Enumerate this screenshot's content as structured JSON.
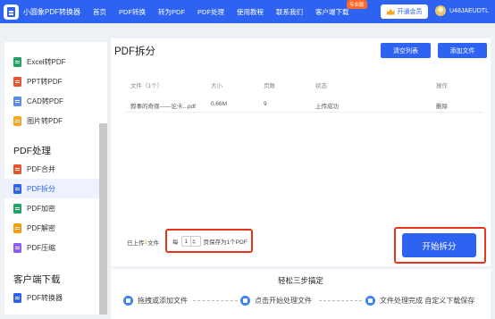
{
  "app": {
    "title": "小圆象PDF转换器"
  },
  "nav": {
    "items": [
      "首页",
      "PDF转换",
      "转为PDF",
      "PDF处理",
      "使用教程",
      "联系我们",
      "客户端下载"
    ],
    "pro_badge": "专业版",
    "vip_button": "开通会员",
    "username": "U48JAEUDTL"
  },
  "sidebar": {
    "top_items": [
      {
        "label": "Excel转PDF",
        "color": "#21a366"
      },
      {
        "label": "PPT转PDF",
        "color": "#e4572e"
      },
      {
        "label": "CAD转PDF",
        "color": "#5b8def"
      },
      {
        "label": "图片转PDF",
        "color": "#f5a623"
      }
    ],
    "section_pdf": "PDF处理",
    "pdf_items": [
      {
        "label": "PDF合并",
        "color": "#e4572e"
      },
      {
        "label": "PDF拆分",
        "color": "#2e63f2",
        "active": true
      },
      {
        "label": "PDF加密",
        "color": "#21a366"
      },
      {
        "label": "PDF解密",
        "color": "#f59e0b"
      },
      {
        "label": "PDF压缩",
        "color": "#8b5cf6"
      }
    ],
    "section_client": "客户端下载",
    "client_item": {
      "label": "PDF转换器",
      "color": "#2e63f2"
    }
  },
  "main": {
    "title": "PDF拆分",
    "clear_button": "清空列表",
    "add_button": "添加文件",
    "columns": {
      "file": "文件（1个）",
      "size": "大小",
      "pages": "页数",
      "status": "状态",
      "action": "操作"
    },
    "rows": [
      {
        "file": "叙事的奇观——论卡...pdf",
        "size": "0.66M",
        "pages": "9",
        "status": "上传成功",
        "action": "删除"
      }
    ],
    "upload_info": {
      "prefix": "已上传",
      "count": "1",
      "suffix": "文件",
      "every": "每",
      "pages_value": "1",
      "save_suffix": "页保存为1个PDF"
    },
    "start_button": "开始拆分"
  },
  "steps": {
    "title": "轻松三步搞定",
    "items": [
      "拖拽或添加文件",
      "点击开始处理文件",
      "文件处理完成 自定义下载保存"
    ]
  },
  "colors": {
    "accent": "#2e63f2",
    "highlight": "#e8361c"
  }
}
